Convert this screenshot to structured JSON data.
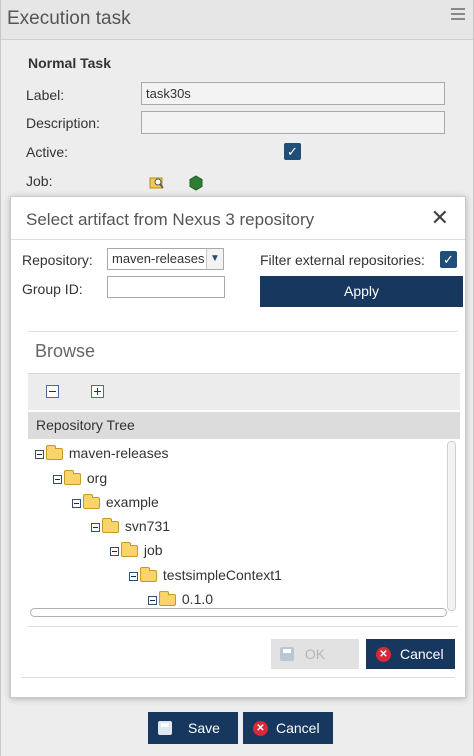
{
  "panel": {
    "title": "Execution task",
    "section_title": "Normal Task",
    "label_label": "Label:",
    "label_value": "task30s",
    "description_label": "Description:",
    "description_value": "",
    "active_label": "Active:",
    "active_checked": true,
    "job_label": "Job:",
    "job_icons": [
      "search-folder-icon",
      "nexus-hexagon-icon"
    ]
  },
  "dialog": {
    "title": "Select artifact from Nexus 3 repository",
    "repository_label": "Repository:",
    "repository_value": "maven-releases",
    "filter_label": "Filter external repositories:",
    "filter_checked": true,
    "group_id_label": "Group ID:",
    "group_id_value": "",
    "apply_label": "Apply",
    "browse_title": "Browse",
    "tree_header": "Repository Tree",
    "tree_nodes": [
      {
        "label": "maven-releases",
        "depth": 0
      },
      {
        "label": "org",
        "depth": 1
      },
      {
        "label": "example",
        "depth": 2
      },
      {
        "label": "svn731",
        "depth": 3
      },
      {
        "label": "job",
        "depth": 4
      },
      {
        "label": "testsimpleContext1",
        "depth": 5
      },
      {
        "label": "0.1.0",
        "depth": 6
      }
    ],
    "ok_label": "OK",
    "cancel_label": "Cancel"
  },
  "footer": {
    "save_label": "Save",
    "cancel_label": "Cancel"
  },
  "colors": {
    "primary": "#17375e",
    "cancel_icon": "#d9283a",
    "folder": "#f7d56a"
  }
}
